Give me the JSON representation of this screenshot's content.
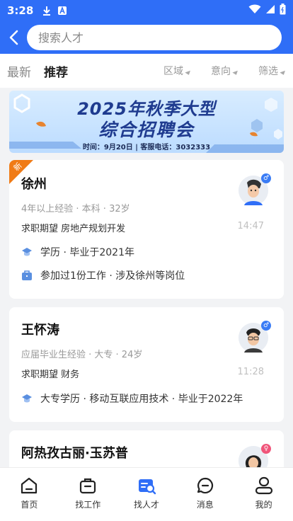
{
  "status": {
    "time": "3:28"
  },
  "search": {
    "placeholder": "搜索人才"
  },
  "tabs": [
    {
      "label": "最新"
    },
    {
      "label": "推荐"
    }
  ],
  "filters": [
    {
      "label": "区域"
    },
    {
      "label": "意向"
    },
    {
      "label": "筛选"
    }
  ],
  "banner": {
    "line1": "2025年秋季大型",
    "line2": "综合招聘会",
    "sub": "时间：9月20日 | 客服电话：3032333"
  },
  "candidates": [
    {
      "badge": "新",
      "name": "徐州",
      "meta": "4年以上经验 · 本科 · 32岁",
      "expect": "求职期望 房地产规划开发",
      "time": "14:47",
      "edu": "学历 · 毕业于2021年",
      "work": "参加过1份工作 · 涉及徐州等岗位",
      "gender": "♂"
    },
    {
      "name": "王怀涛",
      "meta": "应届毕业生经验 · 大专 · 24岁",
      "expect": "求职期望 财务",
      "time": "11:28",
      "edu": "大专学历 · 移动互联应用技术 · 毕业于2022年",
      "gender": "♂"
    },
    {
      "name": "阿热孜古丽·玉苏普",
      "gender": "♀"
    }
  ],
  "nav": [
    {
      "label": "首页",
      "icon": "home-icon"
    },
    {
      "label": "找工作",
      "icon": "briefcase-icon"
    },
    {
      "label": "找人才",
      "icon": "find-talent-icon",
      "active": true
    },
    {
      "label": "消息",
      "icon": "message-icon"
    },
    {
      "label": "我的",
      "icon": "profile-icon"
    }
  ],
  "colors": {
    "primary": "#2f6ef7",
    "new_badge": "#f07b16",
    "male": "#3a7cf5",
    "female": "#f0557a"
  }
}
